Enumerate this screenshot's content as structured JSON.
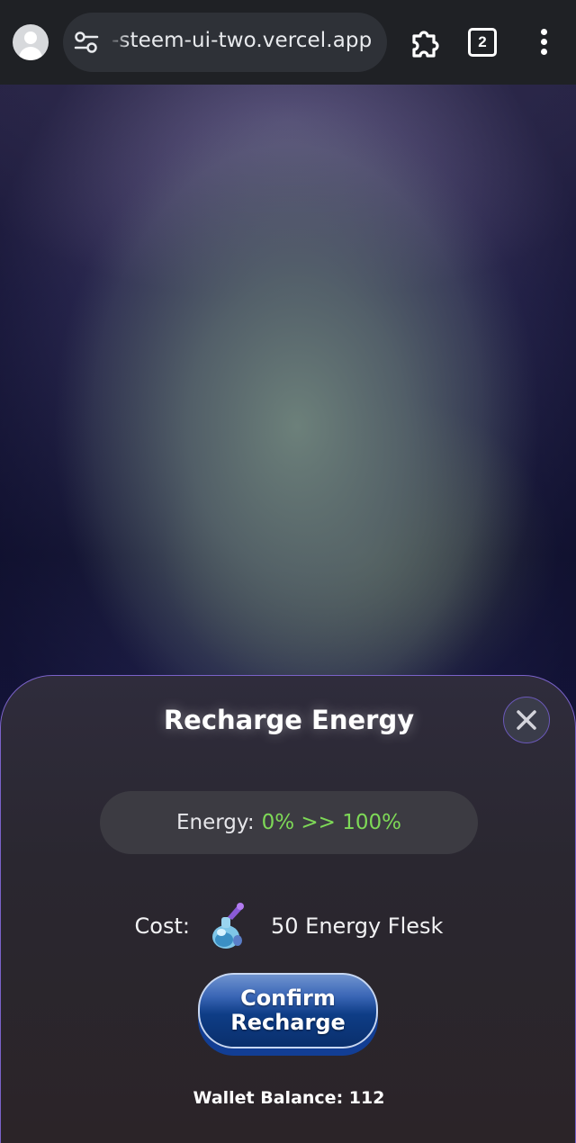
{
  "browser": {
    "url": "-steem-ui-two.vercel.app",
    "tab_count": "2",
    "icons": [
      "account-icon",
      "site-settings-icon",
      "extensions-icon",
      "tab-switcher-icon",
      "more-menu-icon"
    ]
  },
  "modal": {
    "title": "Recharge Energy",
    "close_icon": "close-icon",
    "energy": {
      "label": "Energy:",
      "value": "0% >> 100%"
    },
    "cost": {
      "label": "Cost:",
      "icon": "energy-flask-icon",
      "value": "50 Energy Flesk"
    },
    "confirm_button": "Confirm Recharge",
    "wallet_balance": "Wallet Balance: 112"
  },
  "colors": {
    "accent_green": "#7ed957",
    "modal_border": "#7a62c8",
    "button_blue": "#0e3d86"
  }
}
